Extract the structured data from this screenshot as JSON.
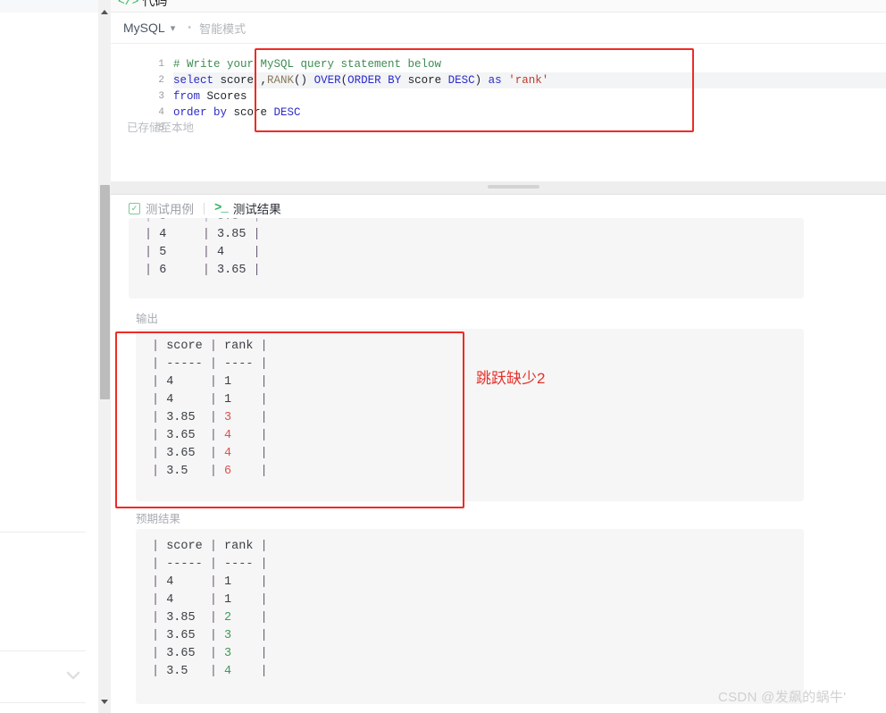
{
  "window": {
    "code_tab_label": "代码",
    "code_tab_icon": "code-brackets-icon"
  },
  "language_bar": {
    "selected_language": "MySQL",
    "chevron": "▾",
    "separator_dot": "•",
    "smart_mode_label": "智能模式"
  },
  "editor": {
    "line_numbers": [
      "1",
      "2",
      "3",
      "4",
      "5"
    ],
    "lines": [
      {
        "n": "1",
        "highlighted": false,
        "tokens": [
          {
            "t": "# Write your MySQL query statement below",
            "c": "cmt"
          }
        ]
      },
      {
        "n": "2",
        "highlighted": true,
        "tokens": [
          {
            "t": "select",
            "c": "k"
          },
          {
            "t": " score ,",
            "c": "plain"
          },
          {
            "t": "RANK",
            "c": "fn"
          },
          {
            "t": "() ",
            "c": "plain"
          },
          {
            "t": "OVER",
            "c": "k"
          },
          {
            "t": "(",
            "c": "plain"
          },
          {
            "t": "ORDER BY",
            "c": "k"
          },
          {
            "t": " score ",
            "c": "plain"
          },
          {
            "t": "DESC",
            "c": "k"
          },
          {
            "t": ") ",
            "c": "plain"
          },
          {
            "t": "as",
            "c": "k"
          },
          {
            "t": " ",
            "c": "plain"
          },
          {
            "t": "'rank'",
            "c": "str"
          }
        ]
      },
      {
        "n": "3",
        "highlighted": false,
        "tokens": [
          {
            "t": "from",
            "c": "k"
          },
          {
            "t": " Scores",
            "c": "plain"
          }
        ]
      },
      {
        "n": "4",
        "highlighted": false,
        "tokens": [
          {
            "t": "order by",
            "c": "k"
          },
          {
            "t": " score ",
            "c": "plain"
          },
          {
            "t": "DESC",
            "c": "k"
          }
        ]
      },
      {
        "n": "5",
        "highlighted": false,
        "tokens": []
      }
    ],
    "saved_note": "已存储至本地"
  },
  "tabs": {
    "testcase_label": "测试用例",
    "testcase_icon": "check-square-icon",
    "testresult_label": "测试结果",
    "testresult_icon": "terminal-prompt-icon",
    "check_glyph": "✓",
    "terminal_glyph": ">_"
  },
  "testcase_table": {
    "visible_rows": [
      {
        "col1": "4",
        "col2": "3.85"
      },
      {
        "col1": "5",
        "col2": "4"
      },
      {
        "col1": "6",
        "col2": "3.65"
      }
    ]
  },
  "output_section": {
    "label": "输出",
    "header": {
      "score": "score",
      "rank": "rank"
    },
    "separator": {
      "score": "-----",
      "rank": "----"
    },
    "rows": [
      {
        "score": "4",
        "rank": "1",
        "rank_color": "normal"
      },
      {
        "score": "4",
        "rank": "1",
        "rank_color": "normal"
      },
      {
        "score": "3.85",
        "rank": "3",
        "rank_color": "red"
      },
      {
        "score": "3.65",
        "rank": "4",
        "rank_color": "red"
      },
      {
        "score": "3.65",
        "rank": "4",
        "rank_color": "red"
      },
      {
        "score": "3.5",
        "rank": "6",
        "rank_color": "red"
      }
    ]
  },
  "expected_section": {
    "label": "预期结果",
    "header": {
      "score": "score",
      "rank": "rank"
    },
    "separator": {
      "score": "-----",
      "rank": "----"
    },
    "rows": [
      {
        "score": "4",
        "rank": "1",
        "rank_color": "normal"
      },
      {
        "score": "4",
        "rank": "1",
        "rank_color": "normal"
      },
      {
        "score": "3.85",
        "rank": "2",
        "rank_color": "green"
      },
      {
        "score": "3.65",
        "rank": "3",
        "rank_color": "green"
      },
      {
        "score": "3.65",
        "rank": "3",
        "rank_color": "green"
      },
      {
        "score": "3.5",
        "rank": "4",
        "rank_color": "green"
      }
    ]
  },
  "annotation": {
    "text": "跳跃缺少2",
    "color": "#e8302a"
  },
  "watermark": {
    "text": "CSDN @发飙的蜗牛'"
  },
  "colors": {
    "annotation_red": "#ee2b25",
    "accent_green": "#2db55d",
    "rank_mismatch_red": "#d9534f",
    "rank_expected_green": "#3f9a5d",
    "keyword_blue": "#2b2bc9",
    "comment_green": "#3d8c53"
  }
}
